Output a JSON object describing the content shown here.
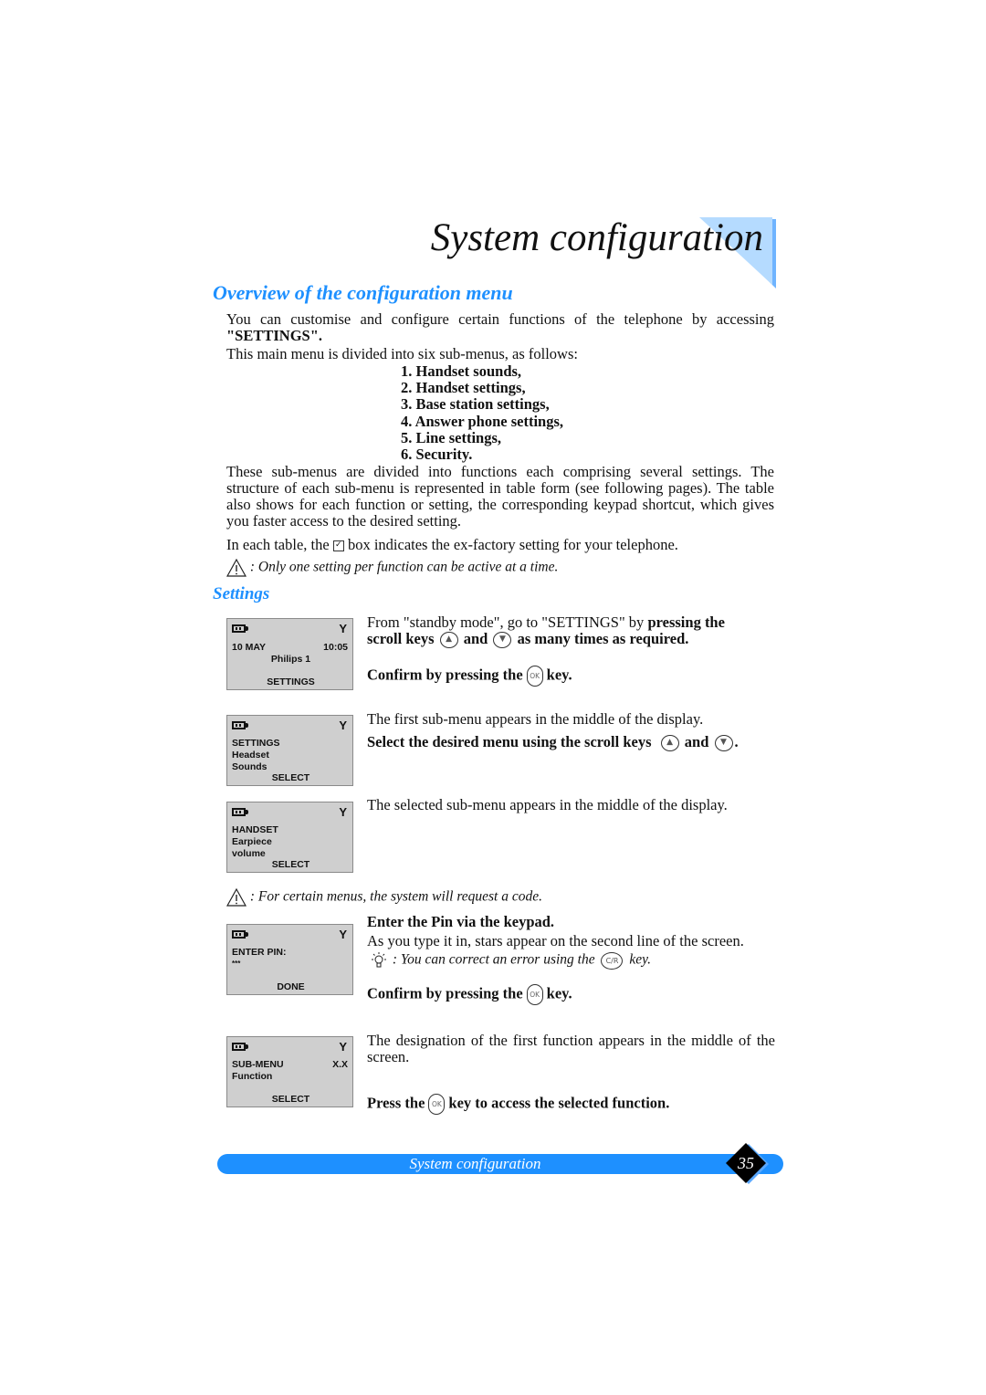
{
  "page": {
    "title": "System configuration",
    "section_heading": "Overview of the configuration menu",
    "intro_line1": "You can customise and configure certain functions of the telephone by accessing",
    "intro_settings": "\"SETTINGS\".",
    "intro_line2": "This main menu is divided into six sub-menus, as follows:",
    "submenus": [
      "1. Handset sounds,",
      "2. Handset settings,",
      "3. Base station settings,",
      "4. Answer phone settings,",
      "5. Line settings,",
      "6. Security."
    ],
    "para_structure": "These sub-menus are divided into functions each comprising several settings. The structure of each sub-menu is represented in table form (see following pages). The table also shows for each function or setting, the corresponding keypad shortcut, which gives you faster access to the desired setting.",
    "para_box_before": "In each table, the",
    "para_box_after": "box indicates the ex-factory setting for your telephone.",
    "note_one_setting": ": Only one setting per function can be active at a time.",
    "settings_heading": "Settings"
  },
  "keys": {
    "up": "▲",
    "down": "▼",
    "ok": "OK",
    "cr": "C/R"
  },
  "steps": {
    "s1_from": "From \"standby mode\", go to \"SETTINGS\" by",
    "s1_bold1": "pressing the",
    "s1_bold2": "scroll keys",
    "s1_and": "and",
    "s1_bold3": "as many times as required.",
    "confirm1_pre": "Confirm by pressing the",
    "confirm1_post": "key.",
    "s2_text": "The first sub-menu appears in the middle of the display.",
    "s2_bold_pre": "Select the desired menu using the scroll keys",
    "s2_and": "and",
    "s2_end": ".",
    "s3_text": "The selected sub-menu appears in the middle of the display.",
    "note_code": ": For certain menus, the system will request a code.",
    "pin_heading": "Enter the Pin via the keypad.",
    "pin_text": "As you type it in, stars appear on the second line of the screen.",
    "tip_pre": ": You can correct an error using the",
    "tip_post": "key.",
    "confirm2_pre": "Confirm by pressing the",
    "confirm2_post": "key.",
    "s5_text": "The designation of the first function appears in the middle of the screen.",
    "press_pre": "Press the",
    "press_post": "key to access the selected function."
  },
  "screens": [
    {
      "name": "standby",
      "date": "10 MAY",
      "time": "10:05",
      "line": "Philips 1",
      "softkey": "SETTINGS"
    },
    {
      "name": "settings",
      "l1": "SETTINGS",
      "l2": "Headset",
      "l3": "Sounds",
      "softkey": "SELECT"
    },
    {
      "name": "handset",
      "l1": "HANDSET",
      "l2": "Earpiece",
      "l3": "volume",
      "softkey": "SELECT"
    },
    {
      "name": "enter-pin",
      "l1": "ENTER PIN:",
      "l2": "***",
      "softkey": "DONE"
    },
    {
      "name": "sub-menu",
      "l1": "SUB-MENU",
      "l1r": "X.X",
      "l2": "Function",
      "softkey": "SELECT"
    }
  ],
  "footer": {
    "title": "System configuration",
    "page_number": "35"
  },
  "colors": {
    "accent_blue": "#1e90ff",
    "light_blue": "#a8d2ff",
    "lcd_gray": "#cfcfcf"
  }
}
